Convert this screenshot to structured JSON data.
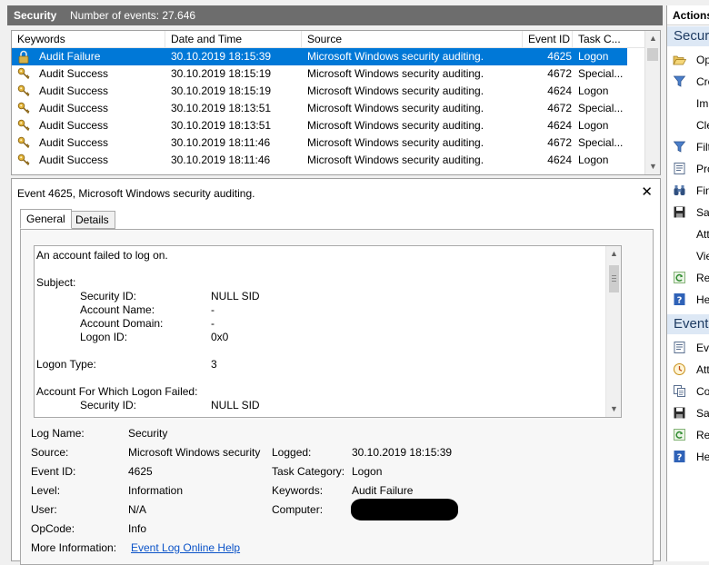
{
  "titlebar": {
    "name": "Security",
    "count_label": "Number of events: 27.646"
  },
  "columns": [
    "Keywords",
    "Date and Time",
    "Source",
    "Event ID",
    "Task C..."
  ],
  "events": [
    {
      "keyword": "Audit Failure",
      "datetime": "30.10.2019 18:15:39",
      "source": "Microsoft Windows security auditing.",
      "event_id": "4625",
      "task": "Logon",
      "icon": "lock-icon",
      "selected": true
    },
    {
      "keyword": "Audit Success",
      "datetime": "30.10.2019 18:15:19",
      "source": "Microsoft Windows security auditing.",
      "event_id": "4672",
      "task": "Special...",
      "icon": "key-icon"
    },
    {
      "keyword": "Audit Success",
      "datetime": "30.10.2019 18:15:19",
      "source": "Microsoft Windows security auditing.",
      "event_id": "4624",
      "task": "Logon",
      "icon": "key-icon"
    },
    {
      "keyword": "Audit Success",
      "datetime": "30.10.2019 18:13:51",
      "source": "Microsoft Windows security auditing.",
      "event_id": "4672",
      "task": "Special...",
      "icon": "key-icon"
    },
    {
      "keyword": "Audit Success",
      "datetime": "30.10.2019 18:13:51",
      "source": "Microsoft Windows security auditing.",
      "event_id": "4624",
      "task": "Logon",
      "icon": "key-icon"
    },
    {
      "keyword": "Audit Success",
      "datetime": "30.10.2019 18:11:46",
      "source": "Microsoft Windows security auditing.",
      "event_id": "4672",
      "task": "Special...",
      "icon": "key-icon"
    },
    {
      "keyword": "Audit Success",
      "datetime": "30.10.2019 18:11:46",
      "source": "Microsoft Windows security auditing.",
      "event_id": "4624",
      "task": "Logon",
      "icon": "key-icon"
    }
  ],
  "details": {
    "title": "Event 4625, Microsoft Windows security auditing.",
    "tabs": [
      "General",
      "Details"
    ],
    "description": {
      "summary": "An account failed to log on.",
      "subject_heading": "Subject:",
      "security_id_label": "Security ID:",
      "security_id_value": "NULL SID",
      "account_name_label": "Account Name:",
      "account_name_value": "-",
      "account_domain_label": "Account Domain:",
      "account_domain_value": "-",
      "logon_id_label": "Logon ID:",
      "logon_id_value": "0x0",
      "logon_type_label": "Logon Type:",
      "logon_type_value": "3",
      "failed_heading": "Account For Which Logon Failed:",
      "failed_security_id_label": "Security ID:",
      "failed_security_id_value": "NULL SID"
    },
    "properties": {
      "log_name_label": "Log Name:",
      "log_name": "Security",
      "source_label": "Source:",
      "source": "Microsoft Windows security",
      "logged_label": "Logged:",
      "logged": "30.10.2019 18:15:39",
      "event_id_label": "Event ID:",
      "event_id": "4625",
      "task_category_label": "Task Category:",
      "task_category": "Logon",
      "level_label": "Level:",
      "level": "Information",
      "keywords_label": "Keywords:",
      "keywords": "Audit Failure",
      "user_label": "User:",
      "user": "N/A",
      "computer_label": "Computer:",
      "opcode_label": "OpCode:",
      "opcode": "Info",
      "more_info_label": "More Information:",
      "more_info_link": "Event Log Online Help"
    }
  },
  "actions": {
    "title": "Actions",
    "sections": [
      {
        "title": "Securi",
        "items": [
          {
            "label": "Op",
            "icon": "open-folder-icon"
          },
          {
            "label": "Cre",
            "icon": "filter-icon"
          },
          {
            "label": "Im",
            "icon": ""
          },
          {
            "label": "Cle",
            "icon": ""
          },
          {
            "label": "Filt",
            "icon": "filter-icon"
          },
          {
            "label": "Pro",
            "icon": "properties-icon"
          },
          {
            "label": "Fin",
            "icon": "binoculars-icon"
          },
          {
            "label": "Sav",
            "icon": "save-icon"
          },
          {
            "label": "Att",
            "icon": ""
          },
          {
            "label": "Vie",
            "icon": ""
          },
          {
            "label": "Ref",
            "icon": "refresh-icon"
          },
          {
            "label": "He",
            "icon": "help-icon"
          }
        ]
      },
      {
        "title": "Event",
        "items": [
          {
            "label": "Eve",
            "icon": "properties-icon"
          },
          {
            "label": "Att",
            "icon": "task-icon"
          },
          {
            "label": "Co",
            "icon": "copy-icon"
          },
          {
            "label": "Sav",
            "icon": "save-icon"
          },
          {
            "label": "Ref",
            "icon": "refresh-icon"
          },
          {
            "label": "He",
            "icon": "help-icon"
          }
        ]
      }
    ]
  },
  "colors": {
    "selection": "#0078d7",
    "titlebar": "#6d6d6d",
    "section_bg": "#dde8f5",
    "link": "#0b53c8"
  }
}
